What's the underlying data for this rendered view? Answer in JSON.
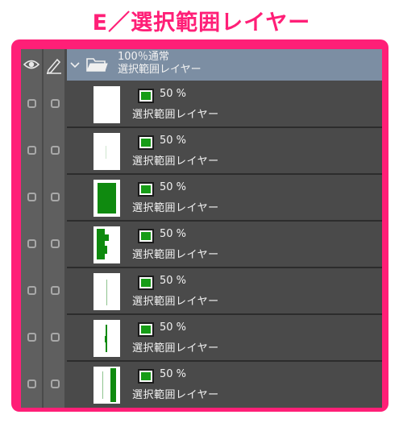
{
  "heading": {
    "text": "E／選択範囲レイヤー",
    "color": "#ff1f77"
  },
  "folder": {
    "opacity_blend": "100％通常",
    "name": "選択範囲レイヤー"
  },
  "layers": [
    {
      "opacity": "50 %",
      "name": "選択範囲レイヤー"
    },
    {
      "opacity": "50 %",
      "name": "選択範囲レイヤー"
    },
    {
      "opacity": "50 %",
      "name": "選択範囲レイヤー"
    },
    {
      "opacity": "50 %",
      "name": "選択範囲レイヤー"
    },
    {
      "opacity": "50 %",
      "name": "選択範囲レイヤー"
    },
    {
      "opacity": "50 %",
      "name": "選択範囲レイヤー"
    },
    {
      "opacity": "50 %",
      "name": "選択範囲レイヤー"
    }
  ],
  "icons": {
    "eye": "eye-icon",
    "pen": "pen-icon",
    "chevron": "chevron-down-icon",
    "folder": "folder-icon",
    "mask": "layer-mask-icon",
    "checkbox": "checkbox-icon"
  },
  "colors": {
    "frame": "#ff1f77",
    "panel": "#4a4a4a",
    "folder_header": "#7c8ea3",
    "mask_green": "#169c16"
  }
}
